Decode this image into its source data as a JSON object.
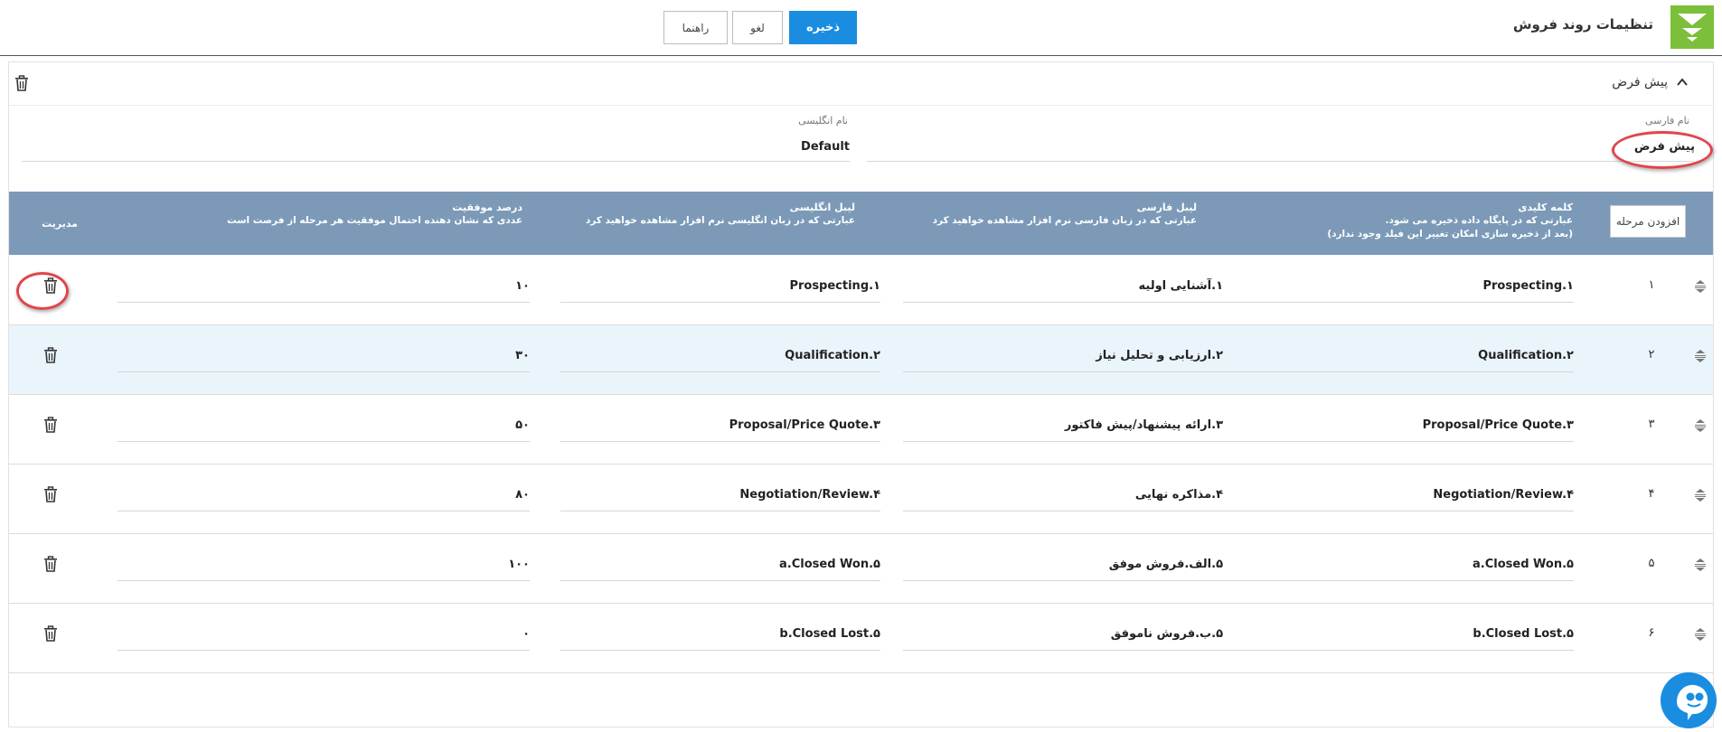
{
  "header": {
    "title": "تنظیمات روند فروش",
    "save_label": "ذخیره",
    "cancel_label": "لغو",
    "help_label": "راهنما"
  },
  "panel": {
    "title": "پیش فرض",
    "persian_name_label": "نام فارسی",
    "persian_name_value": "پیش فرض",
    "english_name_label": "نام انگلیسی",
    "english_name_value": "Default"
  },
  "table": {
    "add_step_label": "افزودن مرحله",
    "columns": {
      "keyword": {
        "title": "کلمه کلیدی",
        "desc1": "عبارتی که در پایگاه داده ذخیره می شود.",
        "desc2": "(بعد از ذخیره سازی امکان تغییر این فیلد وجود ندارد)"
      },
      "persian_label": {
        "title": "لیبل فارسی",
        "desc1": "عبارتی که در زبان فارسی نرم افزار مشاهده خواهید کرد"
      },
      "english_label": {
        "title": "لیبل انگلیسی",
        "desc1": "عبارتی که در زبان انگلیسی نرم افزار مشاهده خواهید کرد"
      },
      "success_percent": {
        "title": "درصد موفقیت",
        "desc1": "عددی که نشان دهنده احتمال موفقیت هر مرحله از فرصت است"
      },
      "manage": {
        "title": "مدیریت"
      }
    },
    "rows": [
      {
        "index": "۱",
        "keyword": "Prospecting.۱",
        "persian": "۱.آشنایی اولیه",
        "english": "Prospecting.۱",
        "percent": "۱۰"
      },
      {
        "index": "۲",
        "keyword": "Qualification.۲",
        "persian": "۲.ارزیابی و تحلیل نیاز",
        "english": "Qualification.۲",
        "percent": "۳۰"
      },
      {
        "index": "۳",
        "keyword": "Proposal/Price Quote.۳",
        "persian": "۳.ارائه پیشنهاد/پیش فاکتور",
        "english": "Proposal/Price Quote.۳",
        "percent": "۵۰"
      },
      {
        "index": "۴",
        "keyword": "Negotiation/Review.۴",
        "persian": "۴.مذاکره نهایی",
        "english": "Negotiation/Review.۴",
        "percent": "۸۰"
      },
      {
        "index": "۵",
        "keyword": "a.Closed Won.۵",
        "persian": "۵.الف.فروش موفق",
        "english": "a.Closed Won.۵",
        "percent": "۱۰۰"
      },
      {
        "index": "۶",
        "keyword": "b.Closed Lost.۵",
        "persian": "۵.ب.فروش ناموفق",
        "english": "b.Closed Lost.۵",
        "percent": "۰"
      }
    ]
  },
  "colors": {
    "primary": "#1a8de0",
    "logo_green": "#7bbf3a",
    "table_header": "#7c9ab8",
    "highlight_red": "#e0454b"
  }
}
